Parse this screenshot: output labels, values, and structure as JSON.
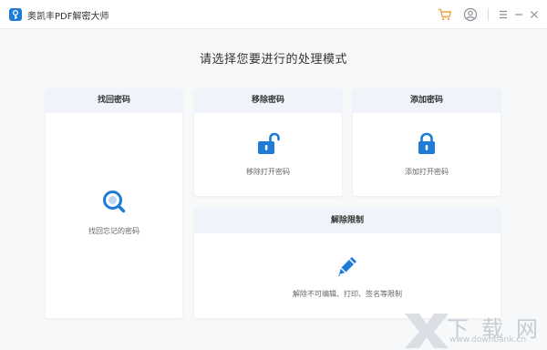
{
  "app": {
    "title": "奥凯丰PDF解密大师",
    "accent_color": "#1e7bd6",
    "cart_color": "#f0a23b"
  },
  "titlebar_icons": [
    "cart-icon",
    "user-icon",
    "menu-icon",
    "minimize-icon",
    "close-icon"
  ],
  "heading": "请选择您要进行的处理模式",
  "cards": {
    "find_password": {
      "title": "找回密码",
      "label": "找回忘记的密码",
      "icon": "search-icon"
    },
    "remove_password": {
      "title": "移除密码",
      "label": "移除打开密码",
      "icon": "unlock-icon"
    },
    "add_password": {
      "title": "添加密码",
      "label": "添加打开密码",
      "icon": "lock-icon"
    },
    "remove_restrictions": {
      "title": "解除限制",
      "label": "解除不可编辑、打印、签名等限制",
      "icon": "pencil-icon"
    }
  },
  "watermark": {
    "text": "下载网",
    "url": "www.downbank.cn"
  }
}
